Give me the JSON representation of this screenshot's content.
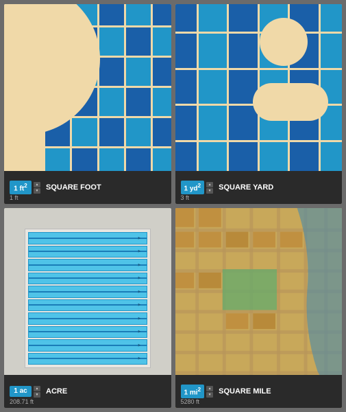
{
  "panels": [
    {
      "id": "square-foot",
      "title": "SQUARE FOOT",
      "unit": "1 ft",
      "superscript": "2",
      "sublabel": "1 ft",
      "accent_color": "#2196c8",
      "bg_color": "#f0d9a8"
    },
    {
      "id": "square-yard",
      "title": "SQUARE YARD",
      "unit": "1 yd",
      "superscript": "2",
      "sublabel": "3 ft",
      "accent_color": "#2196c8",
      "bg_color": "#f0d9a8"
    },
    {
      "id": "acre",
      "title": "ACRE",
      "unit": "1 ac",
      "superscript": "",
      "sublabel": "208.71 ft",
      "accent_color": "#4fc3e8",
      "bg_color": "#d0cfc8"
    },
    {
      "id": "square-mile",
      "title": "SQUARE MILE",
      "unit": "1 mi",
      "superscript": "2",
      "sublabel": "5280 ft",
      "accent_color": "#2196c8",
      "bg_color": "#c8b882"
    }
  ]
}
